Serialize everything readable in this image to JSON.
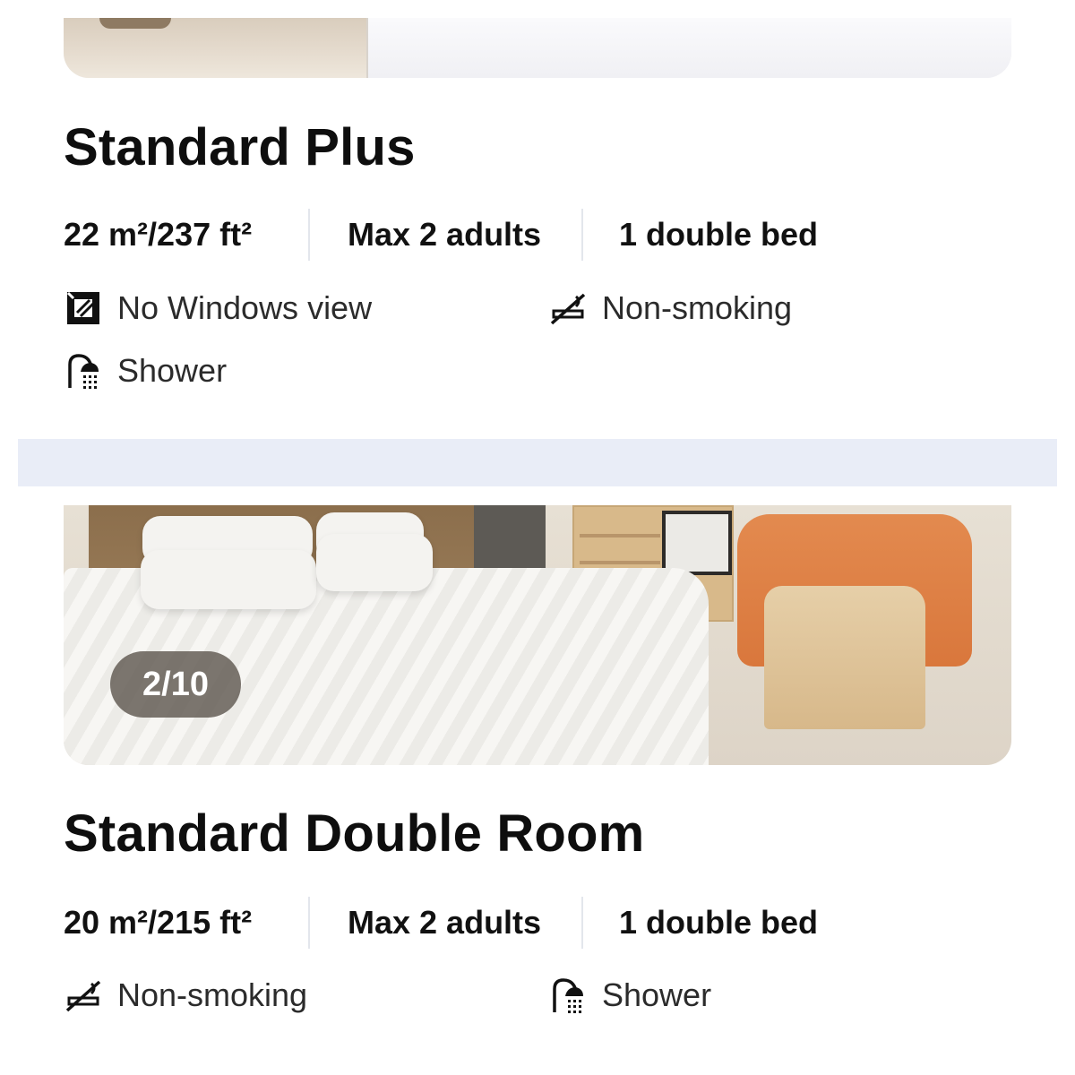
{
  "rooms": [
    {
      "name": "Standard Plus",
      "specs": {
        "size": "22 m²/237 ft²",
        "occupancy": "Max 2 adults",
        "bed": "1 double bed"
      },
      "features": [
        {
          "label": "No Windows view",
          "icon": "no-window-icon"
        },
        {
          "label": "Non-smoking",
          "icon": "no-smoking-icon"
        },
        {
          "label": "Shower",
          "icon": "shower-icon"
        }
      ]
    },
    {
      "name": "Standard Double Room",
      "photo_counter": "2/10",
      "specs": {
        "size": "20 m²/215 ft²",
        "occupancy": "Max 2 adults",
        "bed": "1 double bed"
      },
      "features": [
        {
          "label": "Non-smoking",
          "icon": "no-smoking-icon"
        },
        {
          "label": "Shower",
          "icon": "shower-icon"
        }
      ]
    }
  ],
  "colors": {
    "separator": "#e9edf7",
    "text": "#111111",
    "counter_bg": "#5f5850"
  }
}
